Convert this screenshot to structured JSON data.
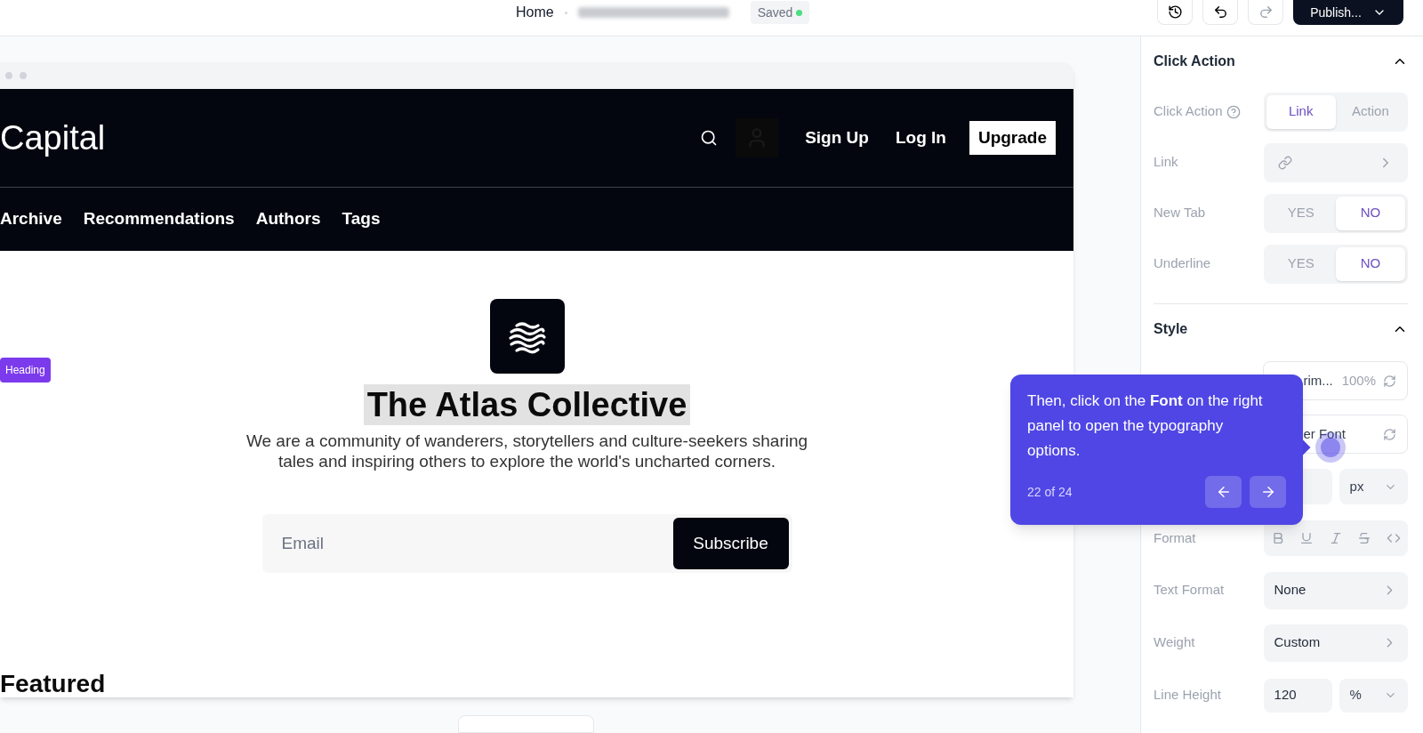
{
  "top_bar": {
    "breadcrumb": "Home",
    "status": "Saved",
    "publish": "Publish..."
  },
  "preview": {
    "logo": "Capital",
    "header_links": [
      "Sign Up",
      "Log In"
    ],
    "cta": "Upgrade",
    "nav": [
      "Archive",
      "Recommendations",
      "Authors",
      "Tags"
    ],
    "badge": "Heading",
    "title": "The Atlas Collective",
    "description": "We are a community of wanderers, storytellers and culture-seekers sharing tales and inspiring others to explore the world's uncharted corners.",
    "email": {
      "placeholder": "Email"
    },
    "subscribe": "Subscribe",
    "section_heading": "Featured"
  },
  "panel": {
    "sections": [
      {
        "title": "Click Action",
        "expanded": true,
        "rows": [
          {
            "kind": "segmented",
            "label": "Click Action",
            "help": true,
            "options": [
              {
                "label": "Link",
                "selected": true
              },
              {
                "label": "Action",
                "selected": false
              }
            ]
          },
          {
            "kind": "link",
            "label": "Link"
          },
          {
            "kind": "segmented",
            "label": "New Tab",
            "options": [
              {
                "label": "YES",
                "selected": false
              },
              {
                "label": "NO",
                "selected": true
              }
            ]
          },
          {
            "kind": "segmented",
            "label": "Underline",
            "options": [
              {
                "label": "YES",
                "selected": false
              },
              {
                "label": "NO",
                "selected": true
              }
            ]
          }
        ]
      },
      {
        "title": "Style",
        "expanded": true,
        "rows": [
          {
            "kind": "color",
            "value": "rim...",
            "opacity": "100%"
          },
          {
            "kind": "font",
            "value": "er Font"
          },
          {
            "kind": "size",
            "unit": "px"
          },
          {
            "kind": "format",
            "label": "Format"
          },
          {
            "kind": "select",
            "label": "Text Format",
            "value": "None"
          },
          {
            "kind": "select",
            "label": "Weight",
            "value": "Custom"
          },
          {
            "kind": "number",
            "label": "Line Height",
            "value": "120",
            "unit": "%"
          }
        ]
      }
    ]
  },
  "tooltip": {
    "text": "Then, click on the **Font** on the right panel to open the typography options.",
    "step": "22 of 24"
  }
}
